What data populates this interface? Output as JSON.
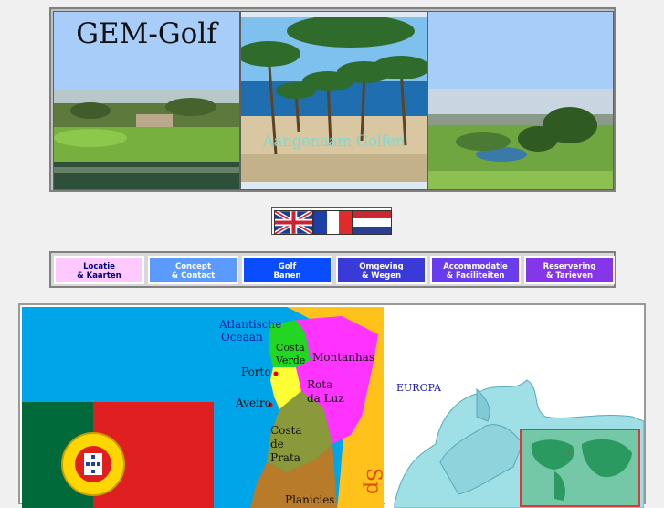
{
  "header": {
    "logo": "GEM-Golf",
    "welcome": "Aangenaam Golfen"
  },
  "languages": [
    {
      "icon": "uk-flag-icon"
    },
    {
      "icon": "french-flag-icon"
    },
    {
      "icon": "dutch-flag-icon"
    }
  ],
  "nav": [
    {
      "line1": "Locatie",
      "line2": "& Kaarten",
      "bg": "#ffc8ff",
      "fg": "#000080"
    },
    {
      "line1": "Concept",
      "line2": "& Contact",
      "bg": "#5b9bff",
      "fg": "#ffffff"
    },
    {
      "line1": "Golf",
      "line2": "Banen",
      "bg": "#0a4cff",
      "fg": "#ffffff"
    },
    {
      "line1": "Omgeving",
      "line2": "& Wegen",
      "bg": "#3a3ad8",
      "fg": "#ffffff"
    },
    {
      "line1": "Accommodatie",
      "line2": "& Faciliteiten",
      "bg": "#6a3cf0",
      "fg": "#ffffff"
    },
    {
      "line1": "Reservering",
      "line2": "& Tarieven",
      "bg": "#8436e8",
      "fg": "#ffffff"
    }
  ],
  "portugal_map": {
    "ocean": "Atlantische Oceaan",
    "ocean_line1": "Atlantische",
    "ocean_line2": "Oceaan",
    "cities": [
      "Porto",
      "Aveiro"
    ],
    "regions": [
      {
        "name1": "Costa",
        "name2": "Verde"
      },
      {
        "name1": "Montanhas",
        "name2": ""
      },
      {
        "name1": "Rota",
        "name2": "da Luz"
      },
      {
        "name1": "Costa",
        "name2": "de"
      },
      {
        "name1": "Prata",
        "name2": ""
      },
      {
        "name1": "Planicies",
        "name2": ""
      }
    ],
    "spain_partial": "Sp"
  },
  "europe_map": {
    "label": "EUROPA"
  }
}
